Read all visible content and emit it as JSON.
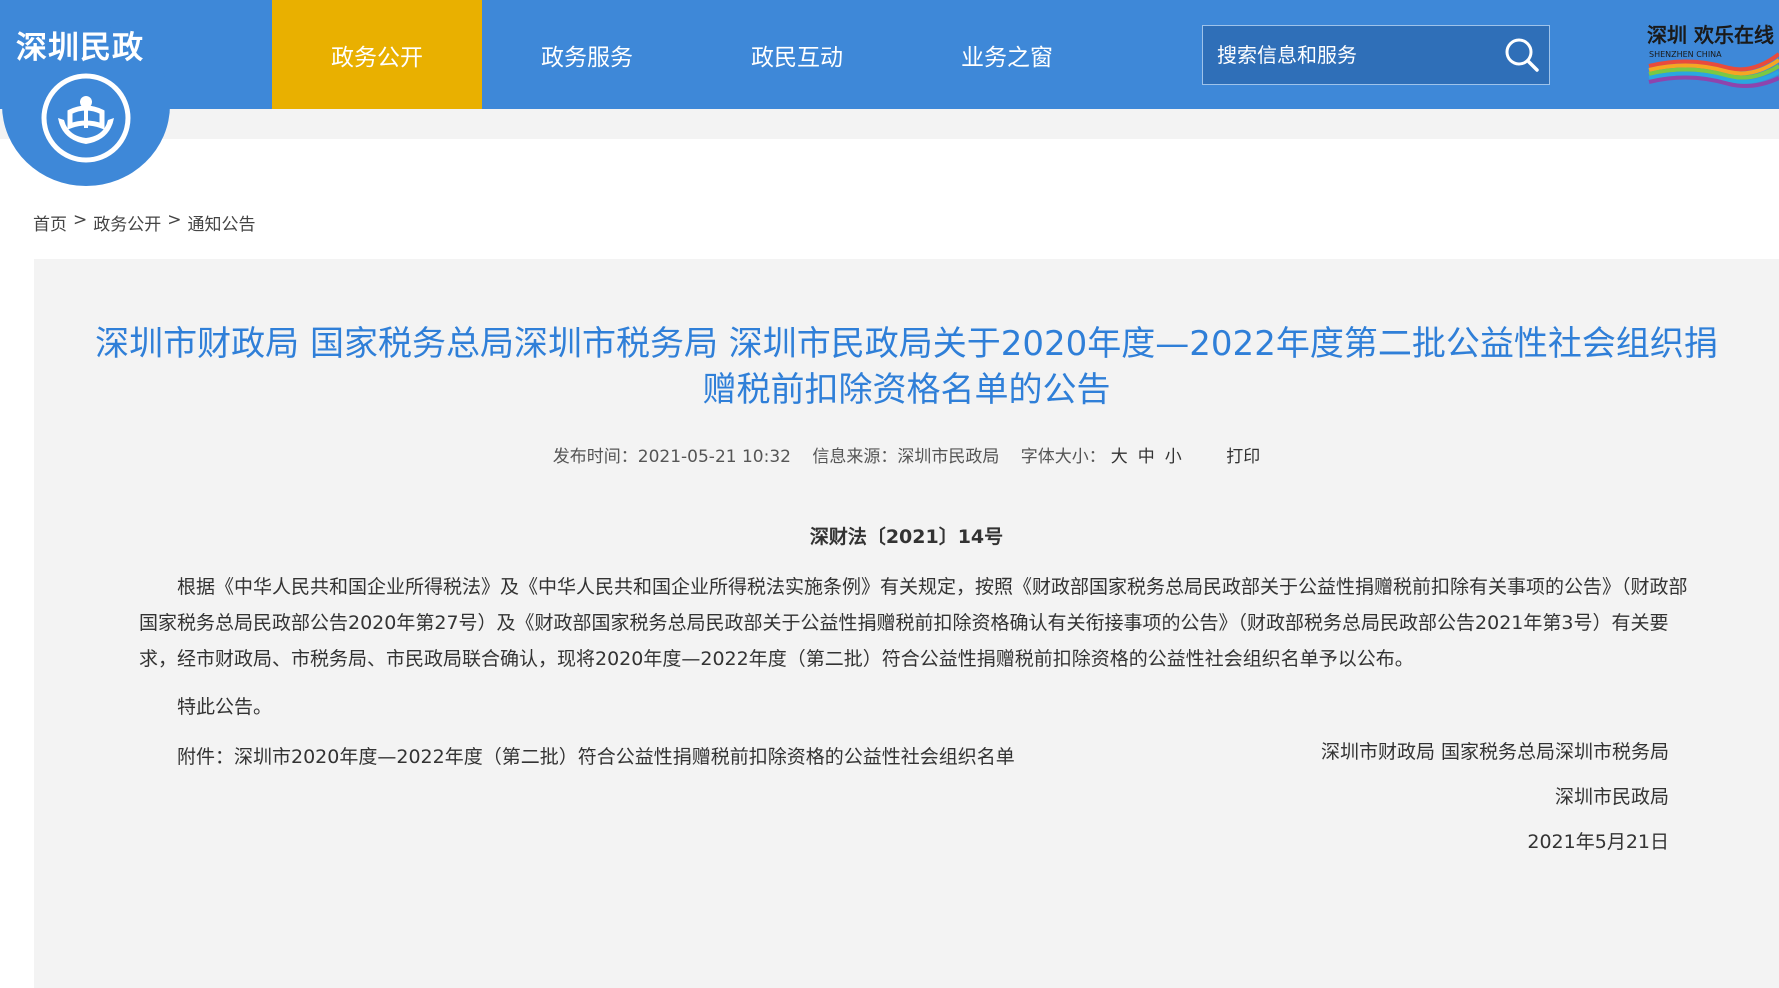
{
  "header": {
    "logo_text": "深圳民政",
    "nav": [
      {
        "label": "政务公开",
        "active": true
      },
      {
        "label": "政务服务",
        "active": false
      },
      {
        "label": "政民互动",
        "active": false
      },
      {
        "label": "业务之窗",
        "active": false
      }
    ],
    "search": {
      "placeholder": "搜索信息和服务",
      "icon": "search-icon"
    },
    "brand": {
      "top_text": "深圳 欢乐在线",
      "bottom_text": "SHENZHEN CHINA"
    }
  },
  "breadcrumb": [
    {
      "label": "首页"
    },
    {
      "label": "政务公开"
    },
    {
      "label": "通知公告"
    }
  ],
  "breadcrumb_sep": ">",
  "article": {
    "title_line1": "深圳市财政局 国家税务总局深圳市税务局 深圳市民政局关于2020年度—2022年度第二批公益性社会组织捐",
    "title_line2": "赠税前扣除资格名单的公告",
    "meta": {
      "publish_label": "发布时间：",
      "publish_time": "2021-05-21 10:32",
      "source_label": "信息来源：",
      "source": "深圳市民政局",
      "font_label": "字体大小：",
      "sizes": [
        "大",
        "中",
        "小"
      ],
      "print": "打印"
    },
    "doc_no": "深财法〔2021〕14号",
    "para1": "根据《中华人民共和国企业所得税法》及《中华人民共和国企业所得税法实施条例》有关规定，按照《财政部国家税务总局民政部关于公益性捐赠税前扣除有关事项的公告》（财政部国家税务总局民政部公告2020年第27号）及《财政部国家税务总局民政部关于公益性捐赠税前扣除资格确认有关衔接事项的公告》（财政部税务总局民政部公告2021年第3号）有关要求，经市财政局、市税务局、市民政局联合确认，现将2020年度—2022年度（第二批）符合公益性捐赠税前扣除资格的公益性社会组织名单予以公布。",
    "para2": "特此公告。",
    "para3": "附件：深圳市2020年度—2022年度（第二批）符合公益性捐赠税前扣除资格的公益性社会组织名单",
    "sign1": "深圳市财政局 国家税务总局深圳市税务局",
    "sign2": "深圳市民政局",
    "sign_date": "2021年5月21日"
  },
  "colors": {
    "primary": "#3e88d8",
    "active_nav": "#e9b000",
    "title": "#2f7fd8"
  }
}
